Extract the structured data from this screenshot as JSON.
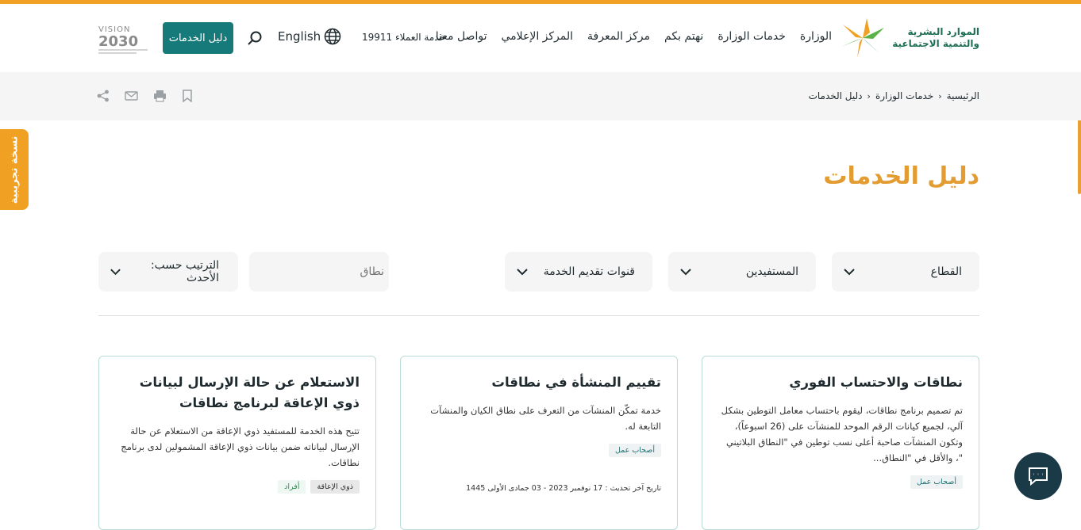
{
  "header": {
    "logo_line1": "الموارد البشرية",
    "logo_line2": "والتنمية الاجتماعية",
    "nav": [
      "الوزارة",
      "خدمات الوزارة",
      "نهتم بكم",
      "مركز المعرفة",
      "المركز الإعلامي",
      "تواصل معنا"
    ],
    "customer_care": "خدمة العملاء 19911",
    "language": "English",
    "guide_button": "دليل الخدمات",
    "vision_label": "VISION",
    "vision_year": "2030"
  },
  "breadcrumb": [
    "الرئيسية",
    "خدمات الوزارة",
    "دليل الخدمات"
  ],
  "beta_tab": "نسخة تجريبية",
  "page_title": "دليل الخدمات",
  "filters": {
    "sector": "القطاع",
    "beneficiaries": "المستفيدين",
    "channels": "قنوات تقديم الخدمة",
    "scope_placeholder": "نطاق",
    "sort": "الترتيب حسب: الأحدث"
  },
  "cards": [
    {
      "title": "نطاقات والاحتساب الفوري",
      "description": "تم تصميم برنامج نطاقات، ليقوم باحتساب معامل التوطين بشكل آلي، لجميع كيانات الرقم الموحد للمنشآت على (26 اسبوعاً)، وتكون المنشآت صاحبة أعلى نسب توطين في \"النطاق البلاتيني \"، والأقل في \"النطاق...",
      "tags": [
        "أصحاب عمل"
      ]
    },
    {
      "title": "تقييم المنشأة في نطاقات",
      "description": "خدمة تمكّن المنشآت من التعرف على نطاق الكيان والمنشآت التابعة له.",
      "tags": [
        "أصحاب عمل"
      ],
      "updated": "تاريخ آخر تحديث : 17 نوفمبر 2023 - 03 جمادى الأولى 1445"
    },
    {
      "title": "الاستعلام عن حالة الإرسال لبيانات ذوي الإعاقة لبرنامج نطاقات",
      "description": "تتيح هذه الخدمة للمستفيد ذوي الإعاقة من الاستعلام عن حالة الإرسال لبياناته ضمن بيانات ذوي الإعاقة المشمولين لدى برنامج نطاقات.",
      "tags": [
        "ذوي الإعاقة",
        "أفراد"
      ]
    }
  ]
}
